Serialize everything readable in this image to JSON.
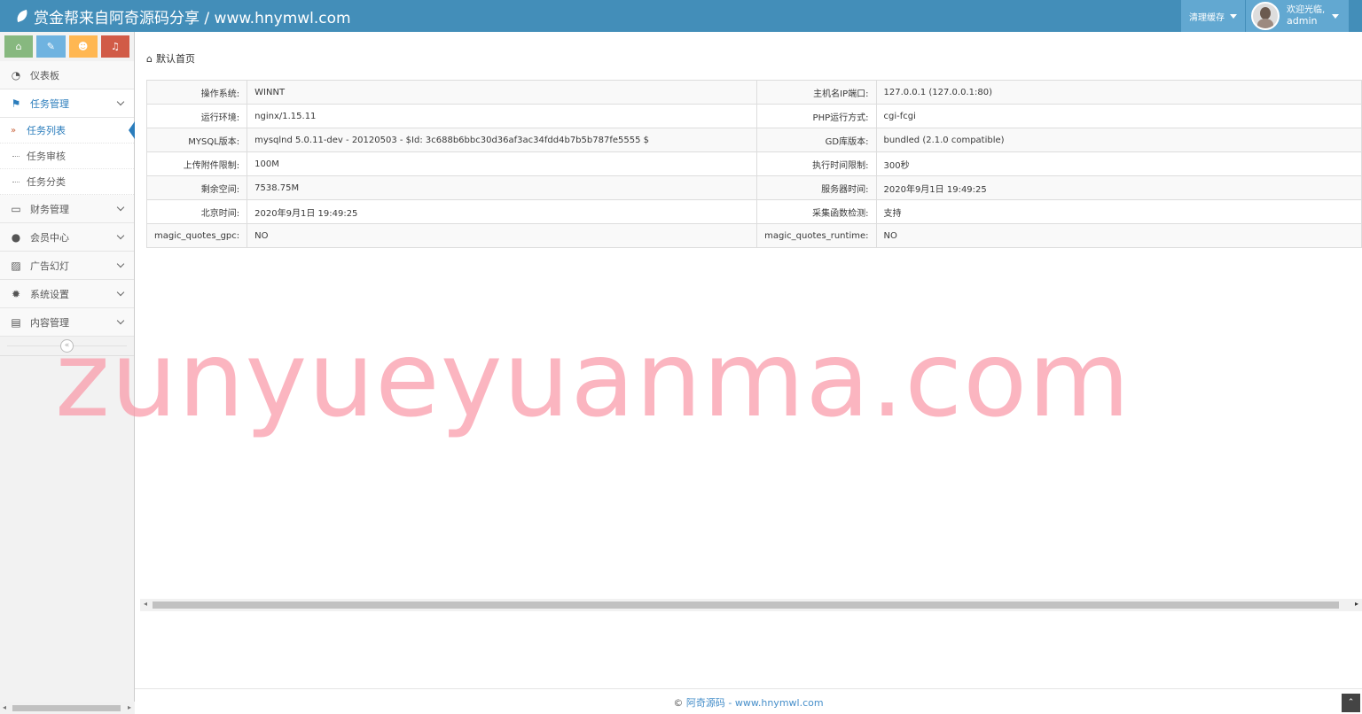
{
  "header": {
    "brand": "赏金帮来自阿奇源码分享 / www.hnymwl.com",
    "clear_cache": "清理缓存",
    "welcome": "欢迎光临,",
    "username": "admin"
  },
  "shortcuts": [
    {
      "icon": "home-icon",
      "glyph": "⌂",
      "color": "#87b87f"
    },
    {
      "icon": "pencil-icon",
      "glyph": "✎",
      "color": "#6fb3e0"
    },
    {
      "icon": "users-icon",
      "glyph": "☻",
      "color": "#ffb752"
    },
    {
      "icon": "bell-icon",
      "glyph": "♫",
      "color": "#d15b47"
    }
  ],
  "sidebar": {
    "dashboard": "仪表板",
    "task_mgmt": "任务管理",
    "task_list": "任务列表",
    "task_review": "任务审核",
    "task_category": "任务分类",
    "finance": "财务管理",
    "members": "会员中心",
    "ads": "广告幻灯",
    "settings": "系统设置",
    "content": "内容管理",
    "collapse": "«"
  },
  "breadcrumb": {
    "home": "默认首页"
  },
  "info": {
    "rows": [
      {
        "l1": "操作系统:",
        "v1": "WINNT",
        "l2": "主机名IP端口:",
        "v2": "127.0.0.1 (127.0.0.1:80)"
      },
      {
        "l1": "运行环境:",
        "v1": "nginx/1.15.11",
        "l2": "PHP运行方式:",
        "v2": "cgi-fcgi"
      },
      {
        "l1": "MYSQL版本:",
        "v1": "mysqlnd 5.0.11-dev - 20120503 - $Id: 3c688b6bbc30d36af3ac34fdd4b7b5b787fe5555 $",
        "l2": "GD库版本:",
        "v2": "bundled (2.1.0 compatible)"
      },
      {
        "l1": "上传附件限制:",
        "v1": "100M",
        "l2": "执行时间限制:",
        "v2": "300秒"
      },
      {
        "l1": "剩余空间:",
        "v1": "7538.75M",
        "l2": "服务器时间:",
        "v2": "2020年9月1日 19:49:25"
      },
      {
        "l1": "北京时间:",
        "v1": "2020年9月1日 19:49:25",
        "l2": "采集函数检测:",
        "v2": "支持"
      },
      {
        "l1": "magic_quotes_gpc:",
        "v1": "NO",
        "l2": "magic_quotes_runtime:",
        "v2": "NO"
      }
    ]
  },
  "footer": {
    "copyright": "©",
    "link": "阿奇源码 - www.hnymwl.com"
  },
  "watermark": "zunyueyuanma.com",
  "colors": {
    "topbar": "#438eb9",
    "accent": "#2b7dbc",
    "watermark": "#fa96a5"
  }
}
